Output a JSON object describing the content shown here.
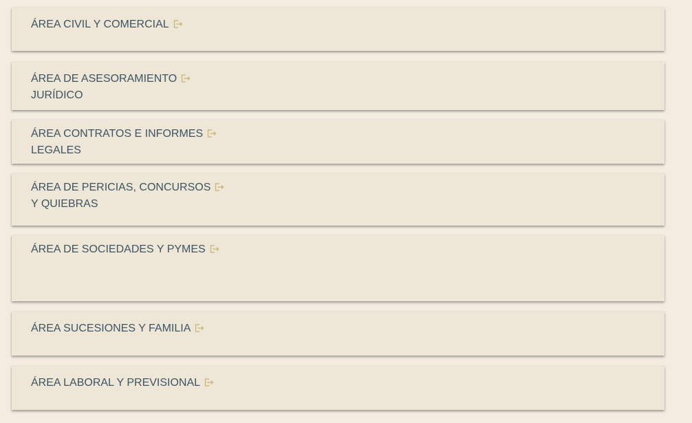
{
  "colors": {
    "page_background": "#f3ede0",
    "card_background": "#eee6d6",
    "text": "#3d5563",
    "icon": "#c8b26e"
  },
  "areas": [
    {
      "line1": "ÁREA CIVIL Y COMERCIAL",
      "line2": "",
      "icon": "external-link-icon"
    },
    {
      "line1": "ÁREA DE ASESORAMIENTO",
      "line2": "JURÍDICO",
      "icon": "external-link-icon"
    },
    {
      "line1": "ÁREA CONTRATOS E INFORMES",
      "line2": "LEGALES",
      "icon": "external-link-icon"
    },
    {
      "line1": "ÁREA DE PERICIAS, CONCURSOS",
      "line2": "Y QUIEBRAS",
      "icon": "external-link-icon"
    },
    {
      "line1": "ÁREA DE SOCIEDADES Y PYMES",
      "line2": "",
      "icon": "external-link-icon"
    },
    {
      "line1": "ÁREA SUCESIONES Y FAMILIA",
      "line2": "",
      "icon": "external-link-icon"
    },
    {
      "line1": "ÁREA LABORAL Y PREVISIONAL",
      "line2": "",
      "icon": "external-link-icon"
    }
  ]
}
